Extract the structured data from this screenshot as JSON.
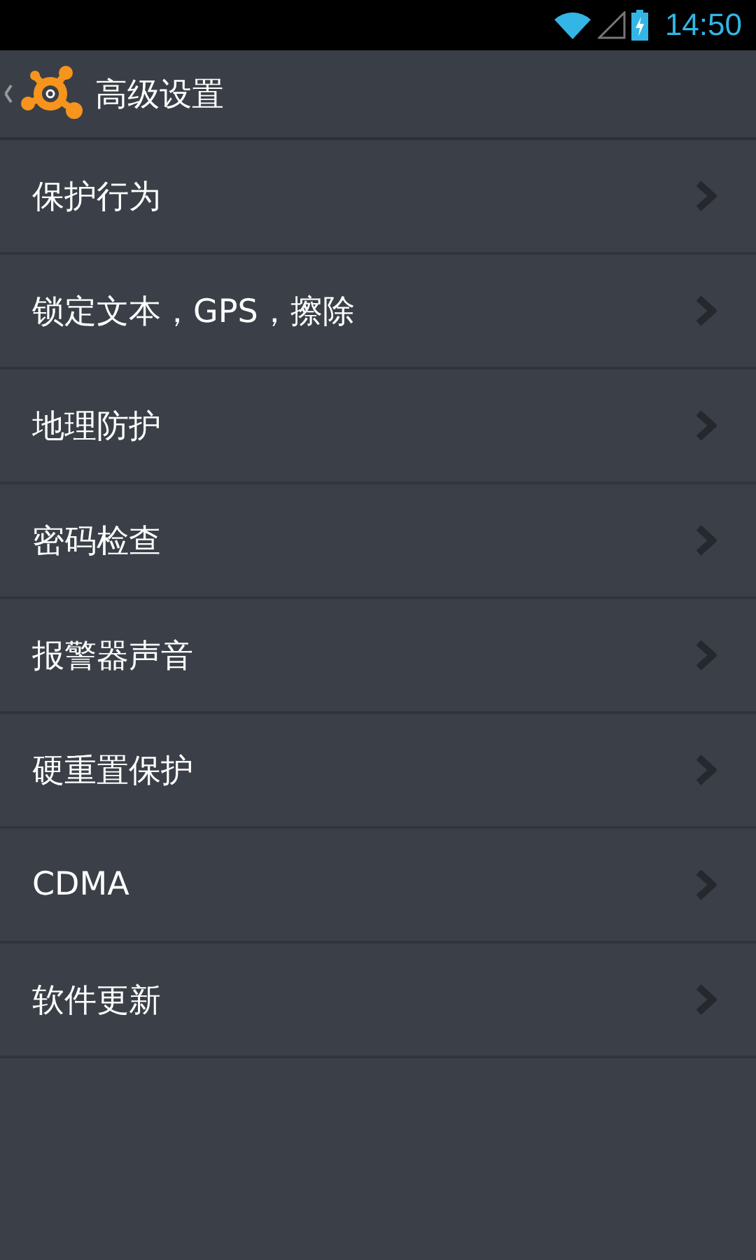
{
  "status_bar": {
    "time": "14:50"
  },
  "header": {
    "title": "高级设置"
  },
  "items": [
    {
      "label": "保护行为"
    },
    {
      "label": "锁定文本，GPS，擦除"
    },
    {
      "label": "地理防护"
    },
    {
      "label": "密码检查"
    },
    {
      "label": "报警器声音"
    },
    {
      "label": "硬重置保护"
    },
    {
      "label": "CDMA"
    },
    {
      "label": "软件更新"
    }
  ]
}
